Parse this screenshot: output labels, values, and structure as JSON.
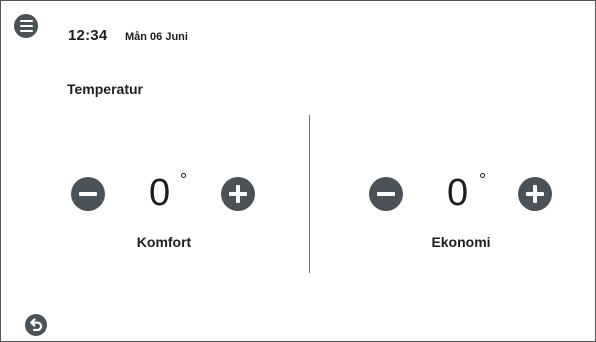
{
  "header": {
    "time": "12:34",
    "date": "Mån 06 Juni",
    "menu_icon": "menu-icon"
  },
  "main": {
    "title": "Temperatur",
    "zones": [
      {
        "label": "Komfort",
        "value": "0",
        "unit": "°"
      },
      {
        "label": "Ekonomi",
        "value": "0",
        "unit": "°"
      }
    ]
  },
  "footer": {
    "back_icon": "back-arrow-icon"
  },
  "colors": {
    "button_fill": "#4a5157",
    "text": "#1e1e1e",
    "frame_border": "#555555",
    "divider": "#707070"
  }
}
